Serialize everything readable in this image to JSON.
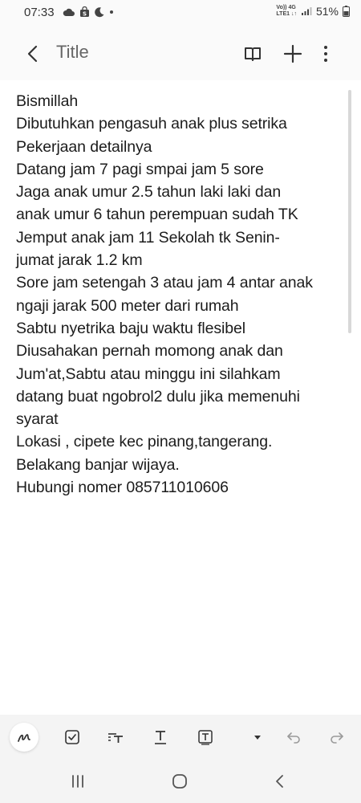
{
  "status_bar": {
    "time": "07:33",
    "network_top": "Vo)) 4G",
    "network_bottom": "LTE1 ↓↑",
    "battery": "51%"
  },
  "app_bar": {
    "title": "Title"
  },
  "note": {
    "lines": [
      "Bismillah",
      "Dibutuhkan pengasuh anak plus setrika",
      "Pekerjaan detailnya",
      "Datang jam 7 pagi smpai jam 5 sore",
      "Jaga anak umur 2.5 tahun laki laki dan",
      "anak umur 6 tahun perempuan sudah TK",
      "Jemput anak jam 11 Sekolah tk Senin-",
      "jumat jarak 1.2 km",
      "Sore jam setengah 3 atau jam 4 antar anak",
      "ngaji jarak 500 meter dari rumah",
      "Sabtu nyetrika baju waktu flesibel",
      "Diusahakan pernah momong anak dan",
      "Jum'at,Sabtu atau minggu ini silahkam",
      "datang buat ngobrol2 dulu jika memenuhi",
      "syarat",
      "Lokasi , cipete kec pinang,tangerang.",
      "Belakang banjar wijaya.",
      "Hubungi nomer 085711010606"
    ]
  },
  "icons": {
    "back": "chevron-left-icon",
    "reading_mode": "book-icon",
    "add": "plus-icon",
    "more": "more-vertical-icon",
    "pen": "pen-icon",
    "checkbox": "checkbox-icon",
    "text_style": "text-style-icon",
    "underline": "underline-text-icon",
    "text_box": "text-box-icon",
    "dropdown": "dropdown-arrow-icon",
    "undo": "undo-icon",
    "redo": "redo-icon",
    "recent_apps": "recent-apps-icon",
    "home": "home-icon",
    "nav_back": "nav-back-icon"
  },
  "colors": {
    "background": "#ffffff",
    "bars": "#f4f4f4",
    "text": "#1c1c1c",
    "icon": "#333333",
    "muted_icon": "#9a9a9a"
  }
}
